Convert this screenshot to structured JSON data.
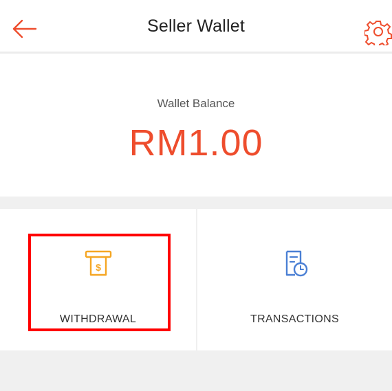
{
  "header": {
    "title": "Seller Wallet",
    "back_icon": "arrow-left-icon",
    "settings_icon": "gear-icon"
  },
  "balance": {
    "label": "Wallet Balance",
    "amount": "RM1.00"
  },
  "actions": [
    {
      "label": "WITHDRAWAL",
      "icon": "atm-withdrawal-icon",
      "color": "#f5a623"
    },
    {
      "label": "TRANSACTIONS",
      "icon": "document-clock-icon",
      "color": "#4a7fd4"
    }
  ],
  "colors": {
    "accent": "#ee4d2d",
    "highlight_box": "#ff0000"
  }
}
